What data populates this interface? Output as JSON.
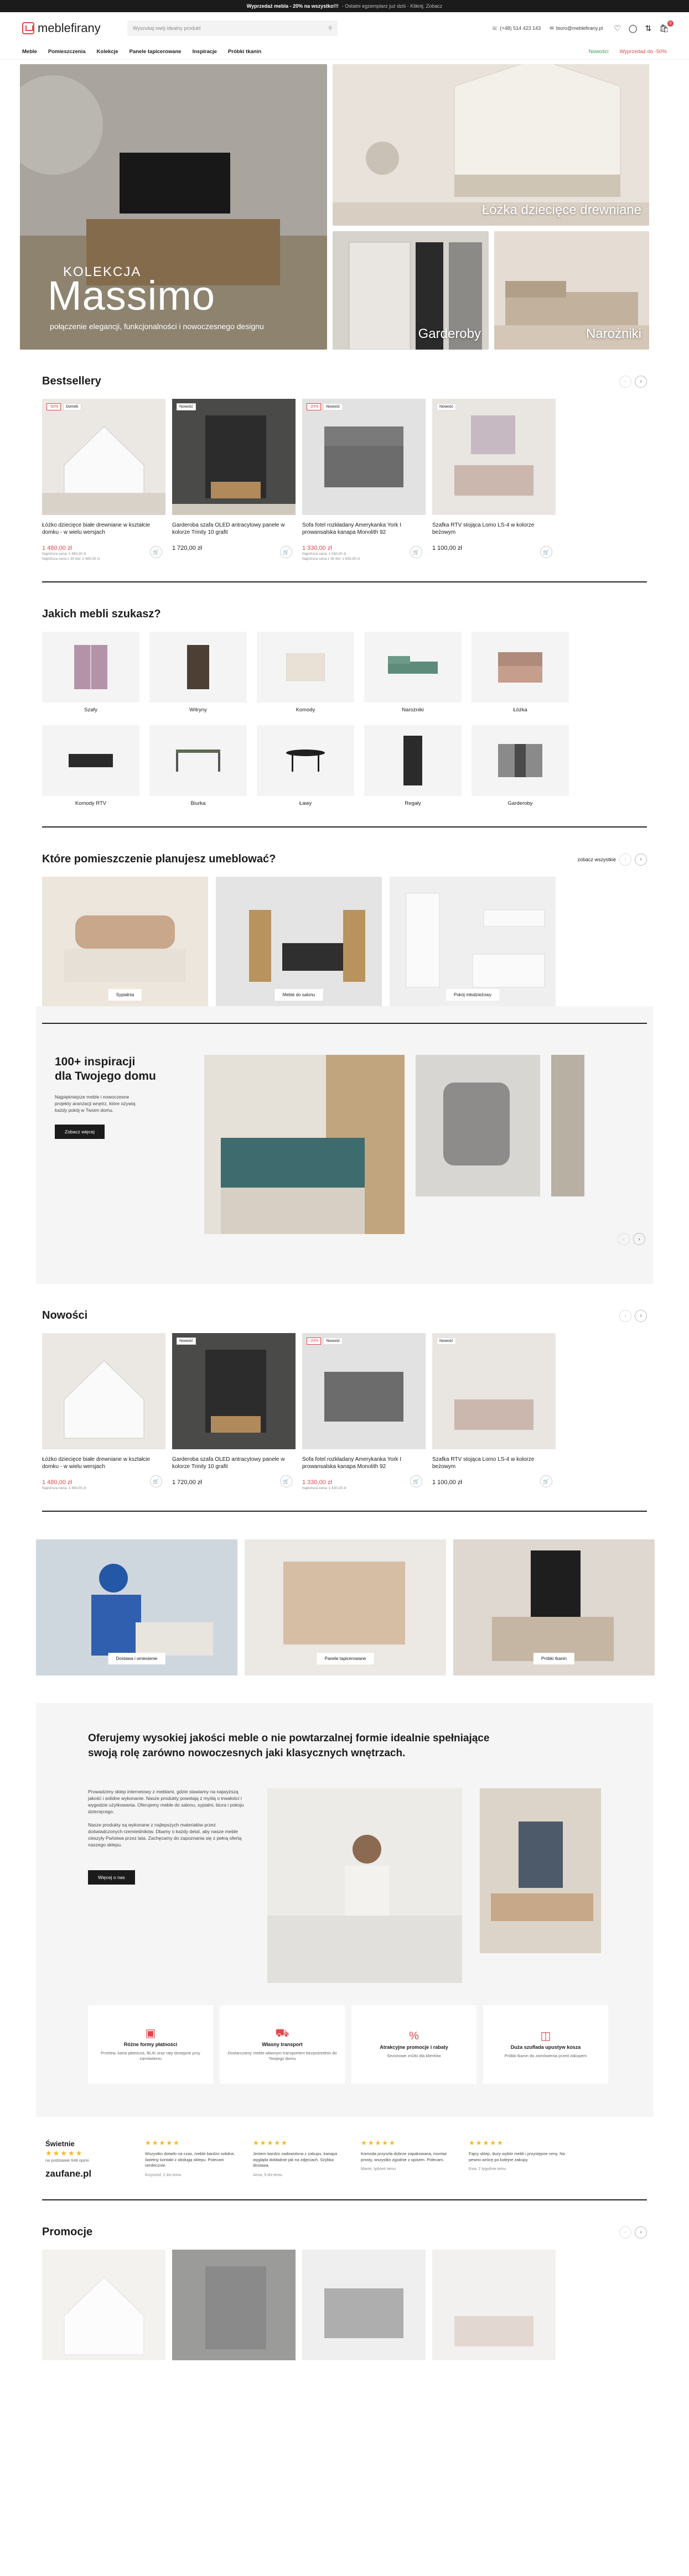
{
  "topbar": {
    "prefix": "Wyprzedaż mebla - 20% na wszystko!!!",
    "rest": "- Ostatni egzemplarz już dziś - Kliknij. Zobacz"
  },
  "header": {
    "logo": "meblefirany",
    "search_placeholder": "Wyszukaj swój idealny produkt",
    "phone": "(+48) 514 423 143",
    "email": "biuro@meblefirany.pl",
    "cart_count": "0"
  },
  "nav": {
    "items": [
      "Meble",
      "Pomieszczenia",
      "Kolekcje",
      "Panele tapicerowane",
      "Inspiracje",
      "Próbki tkanin"
    ],
    "green_link": "Nowości",
    "red_link": "Wyprzedaż do -50%"
  },
  "hero": {
    "kolekcja": "KOLEKCJA",
    "massimo": "Massimo",
    "massimo_sub": "połączenie elegancji, funkcjonalności i nowoczesnego designu",
    "kids": "Łóżka dziecięce drewniane",
    "wardrobes": "Garderoby",
    "corners": "Narożniki"
  },
  "bestsellers": {
    "title": "Bestsellery",
    "products": [
      {
        "name": "Łóżko dziecięce białe drewniane w kształcie domku - w wielu wersjach",
        "price": "1 480,00 zł",
        "tags": [
          "-50%",
          "Domek"
        ],
        "lowest": "Najniższa cena: 1 480,00 zł",
        "note": "Najniższa cena z 30 dni: 1 480,00 zł"
      },
      {
        "name": "Garderoba szafa OLED antracytowy panele w kolorze Trinity 10 grafit",
        "price": "1 720,00 zł",
        "tags": [
          "Nowość"
        ]
      },
      {
        "name": "Sofa fotel rozkładany Amerykanka York I prowansalska kanapa Monolith 92",
        "price": "1 330,00 zł",
        "tags": [
          "-20%",
          "Nowość"
        ],
        "lowest": "Najniższa cena: 1 630,00 zł",
        "note": "Najniższa cena z 30 dni: 1 630,00 zł"
      },
      {
        "name": "Szafka RTV stojąca Lomo LS-4 w kolorze beżowym",
        "price": "1 100,00 zł",
        "tags": [
          "Nowość"
        ]
      }
    ]
  },
  "categories": {
    "title": "Jakich mebli szukasz?",
    "items": [
      "Szafy",
      "Witryny",
      "Komody",
      "Narożniki",
      "Łóżka",
      "Komody RTV",
      "Biurka",
      "Ławy",
      "Regały",
      "Garderoby"
    ]
  },
  "rooms": {
    "title": "Które pomieszczenie planujesz umeblować?",
    "see_all": "zobacz wszystkie",
    "items": [
      "Sypialnia",
      "Meble do salonu",
      "Pokój młodzieżowy"
    ]
  },
  "inspiration": {
    "title_line1": "100+ inspiracji",
    "title_line2": "dla Twojego domu",
    "desc": "Najpiękniejsze meble i nowoczesne projekty aranżacji wnętrz, które ożywią każdy pokój w Twoim domu.",
    "button": "Zobacz więcej"
  },
  "news": {
    "title": "Nowości"
  },
  "three_tiles": [
    "Dostawa i wniesienie",
    "Panele tapicerowane",
    "Próbki tkanin"
  ],
  "about": {
    "title": "Oferujemy wysokiej jakości meble o nie powtarzalnej formie idealnie spełniające swoją rolę zarówno nowoczesnych jaki klasycznych wnętrzach.",
    "p1": "Prowadzimy sklep internetowy z meblami, gdzie stawiamy na najwyższą jakość i solidne wykonanie. Nasze produkty powstają z myślą o trwałości i wygodzie użytkowania. Oferujemy meble do salonu, sypialni, biura i pokoju dziecięcego.",
    "p2": "Nasze produkty są wykonane z najlepszych materiałów przez doświadczonych rzemieślników. Dbamy o każdy detal, aby nasze meble cieszyły Państwa przez lata. Zachęcamy do zapoznania się z pełną ofertą naszego sklepu.",
    "button": "Więcej o nas"
  },
  "features": [
    {
      "title": "Różne formy płatności",
      "desc": "Przelew, karta płatnicza, BLIK oraz raty dostępne przy zamówieniu"
    },
    {
      "title": "Własny transport",
      "desc": "Dostarczamy meble własnym transportem bezpośrednio do Twojego domu"
    },
    {
      "title": "Atrakcyjne promocje i rabaty",
      "desc": "Sezonowe zniżki dla klientów"
    },
    {
      "title": "Duża szuflada upustyw kosza",
      "desc": "Próbki tkanin do zamówienia przed zakupem"
    }
  ],
  "reviews": {
    "heading": "Świetnie",
    "based": "na podstawie 648 opinii",
    "brand": "zaufane.pl",
    "items": [
      {
        "text": "Wszystko dotarło na czas, meble bardzo solidne, świetny kontakt z obsługą sklepu. Polecam serdecznie.",
        "who": "Krzysztof, 2 dni temu"
      },
      {
        "text": "Jestem bardzo zadowolona z zakupu, kanapa wygląda dokładnie jak na zdjęciach. Szybka dostawa.",
        "who": "Anna, 5 dni temu"
      },
      {
        "text": "Komoda przyszła dobrze zapakowana, montaż prosty, wszystko zgodnie z opisem. Polecam.",
        "who": "Marek, tydzień temu"
      },
      {
        "text": "Fajny sklep, duży wybór mebli i przystępne ceny. Na pewno wrócę po kolejne zakupy.",
        "who": "Ewa, 2 tygodnie temu"
      }
    ]
  },
  "promo": {
    "title": "Promocje"
  },
  "colors": {
    "accent": "#e0474c",
    "dark": "#1b1b1b",
    "green": "#2e9d4f",
    "star": "#f2b820"
  }
}
